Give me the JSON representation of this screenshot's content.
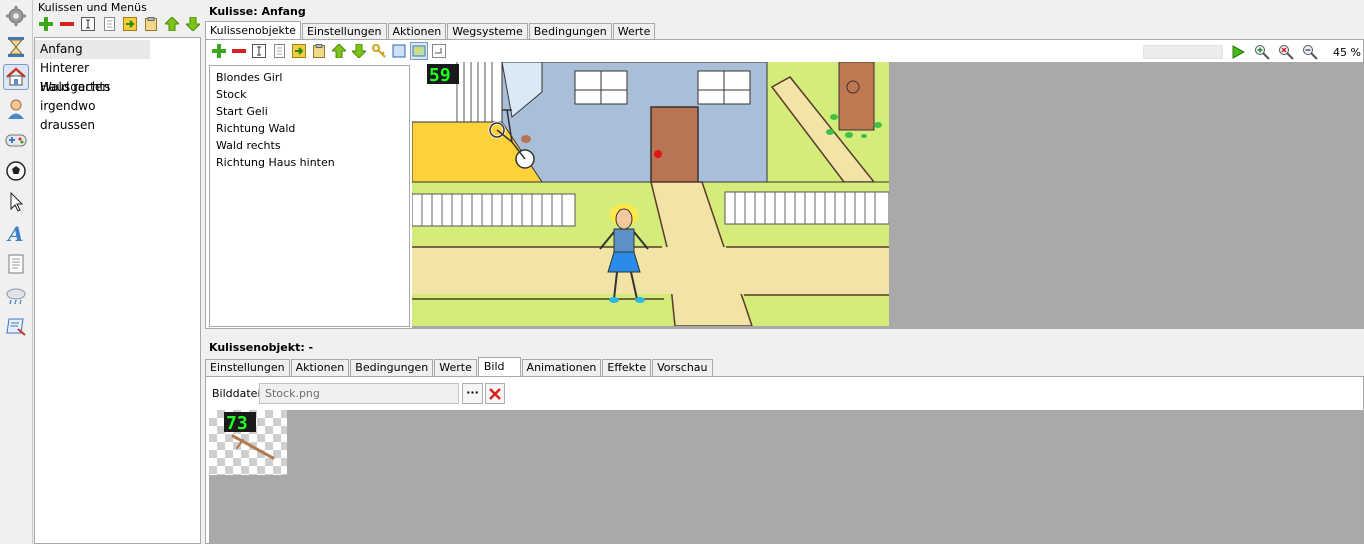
{
  "scene_panel": {
    "title": "Kulissen und Menüs",
    "scenes": [
      {
        "label": "Anfang",
        "selected": true
      },
      {
        "label": "Hinterer Hausgarten",
        "selected": false
      },
      {
        "label": "Wald rechts",
        "selected": false
      },
      {
        "label": "irgendwo draussen",
        "selected": false
      }
    ]
  },
  "rail_icons": [
    "gear-icon",
    "hourglass-icon",
    "house-icon",
    "person-icon",
    "gamepad-icon",
    "ball-icon",
    "cursor-icon",
    "font-icon",
    "document-icon",
    "weather-icon",
    "script-icon"
  ],
  "scene_editor": {
    "heading": "Kulisse: Anfang",
    "tabs": [
      "Kulissenobjekte",
      "Einstellungen",
      "Aktionen",
      "Wegsysteme",
      "Bedingungen",
      "Werte"
    ],
    "active_tab": 0,
    "objects": [
      "Blondes Girl",
      "Stock",
      "Start Geli",
      "Richtung Wald",
      "Wald rechts",
      "Richtung Haus hinten"
    ],
    "overlay_number": "59",
    "zoom": "45 %"
  },
  "object_editor": {
    "heading": "Kulissenobjekt: -",
    "tabs": [
      "Einstellungen",
      "Aktionen",
      "Bedingungen",
      "Werte",
      "Bild",
      "Animationen",
      "Effekte",
      "Vorschau"
    ],
    "active_tab": 4,
    "image_label": "Bilddatei",
    "image_file": "Stock.png",
    "browse_label": "···",
    "preview_number": "73"
  },
  "colors": {
    "add_green": "#3aa81a",
    "remove_red": "#d92020",
    "arrow_green": "#7cc417",
    "play_green": "#45b81a",
    "overlay_green": "#1eff1e"
  }
}
